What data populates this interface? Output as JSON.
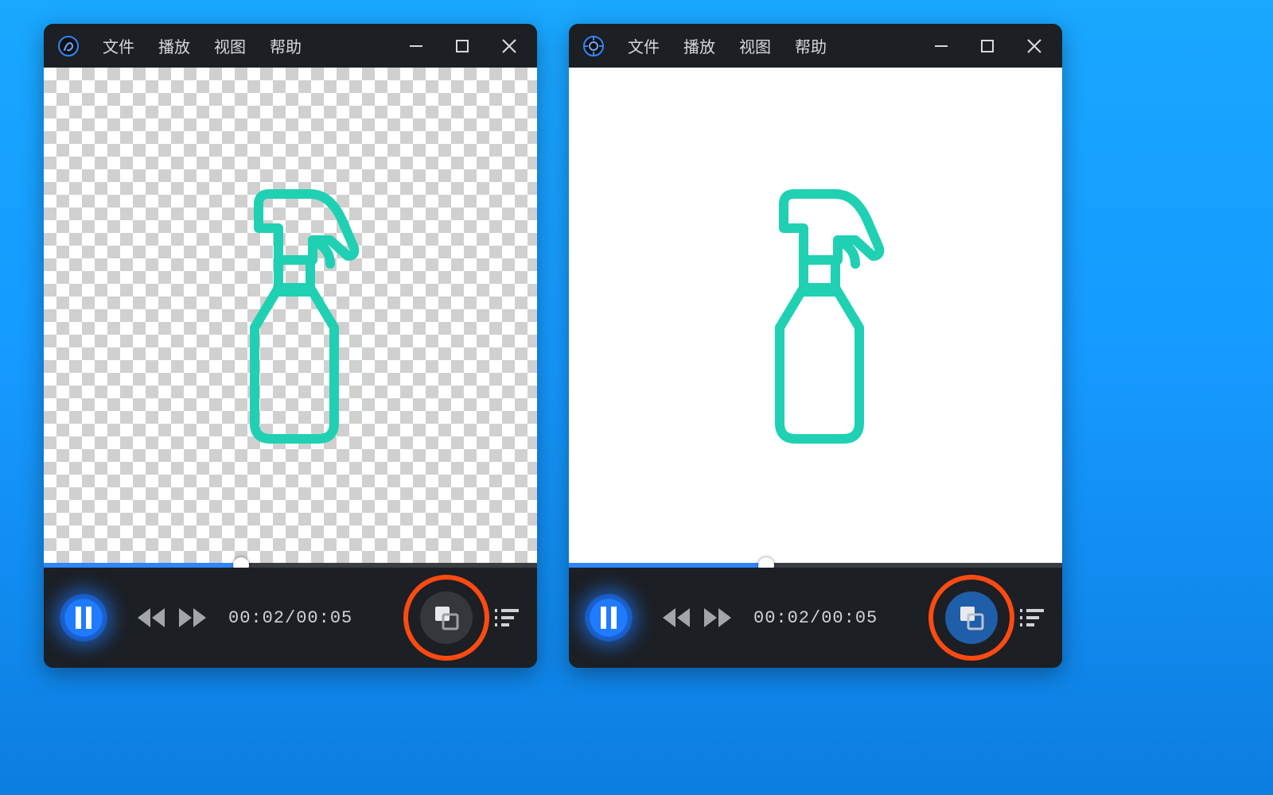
{
  "menu": {
    "file": "文件",
    "play": "播放",
    "view": "视图",
    "help": "帮助"
  },
  "playback": {
    "current": "00:02",
    "sep": "/",
    "total": "00:05",
    "progress_percent": 40
  }
}
